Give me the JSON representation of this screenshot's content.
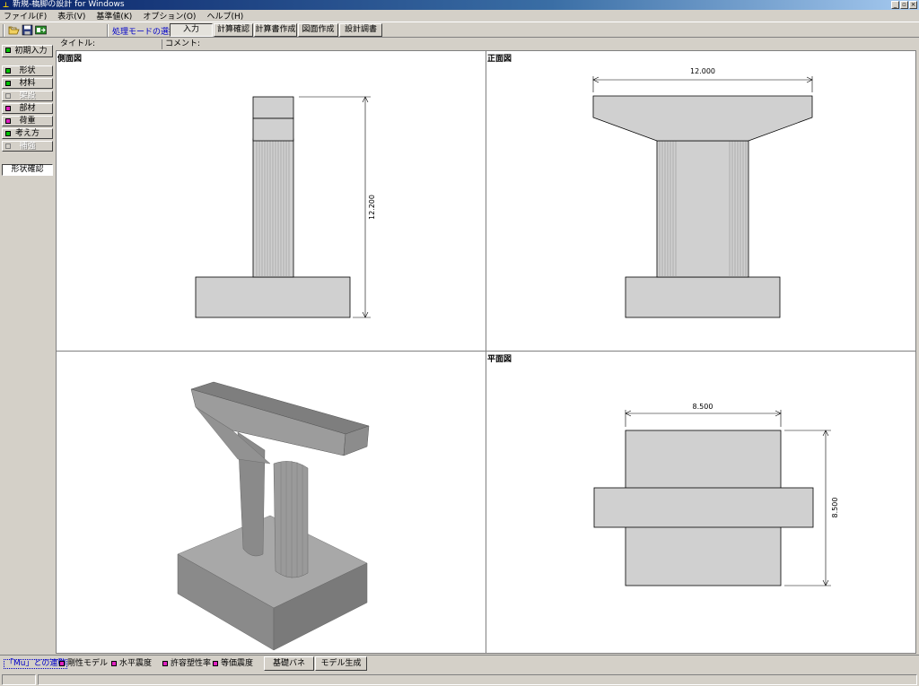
{
  "window": {
    "title": "新規-橋脚の設計 for Windows",
    "app_icon_glyph": "⊥",
    "buttons": [
      "minimize",
      "restore",
      "close"
    ]
  },
  "menu": [
    "ファイル(F)",
    "表示(V)",
    "基準値(K)",
    "オプション(O)",
    "ヘルプ(H)"
  ],
  "toolbar": {
    "icons": [
      "open-folder-icon",
      "save-disk-icon",
      "export-icon"
    ],
    "mode_label": "処理モードの選択",
    "mode_buttons": [
      "入力",
      "計算確認",
      "計算書作成",
      "図面作成",
      "設計調書"
    ],
    "selected_mode": "入力"
  },
  "left_panel": {
    "initial_input": "初期入力",
    "items": [
      {
        "label": "形状",
        "color": "#00c000",
        "enabled": true
      },
      {
        "label": "材料",
        "color": "#00c000",
        "enabled": true
      },
      {
        "label": "架設",
        "color": "#d4d0c8",
        "enabled": false
      },
      {
        "label": "部材",
        "color": "#e020c0",
        "enabled": true
      },
      {
        "label": "荷重",
        "color": "#e020c0",
        "enabled": true
      },
      {
        "label": "考え方",
        "color": "#00c000",
        "enabled": true
      },
      {
        "label": "補強",
        "color": "#d4d0c8",
        "enabled": false
      }
    ],
    "shape_confirm": "形状確認"
  },
  "info": {
    "title_label": "タイトル:",
    "comment_label": "コメント:"
  },
  "views": {
    "side": {
      "label": "側面図",
      "height_dim": "12.200"
    },
    "front": {
      "label": "正面図",
      "width_dim": "12.000"
    },
    "iso": {
      "label": ""
    },
    "plan": {
      "label": "平面図",
      "width_dim": "8.500",
      "depth_dim": "8.500"
    }
  },
  "bottom": {
    "link": "「Mu」との連動",
    "items": [
      "剛性モデル",
      "水平震度",
      "許容塑性率",
      "等価震度"
    ],
    "buttons": [
      "基礎バネ",
      "モデル生成"
    ]
  },
  "colors": {
    "selected_green": "#00c000",
    "magenta": "#e020c0",
    "mode_label_blue": "#0000c8",
    "concrete_gray": "#d0d0d0"
  }
}
